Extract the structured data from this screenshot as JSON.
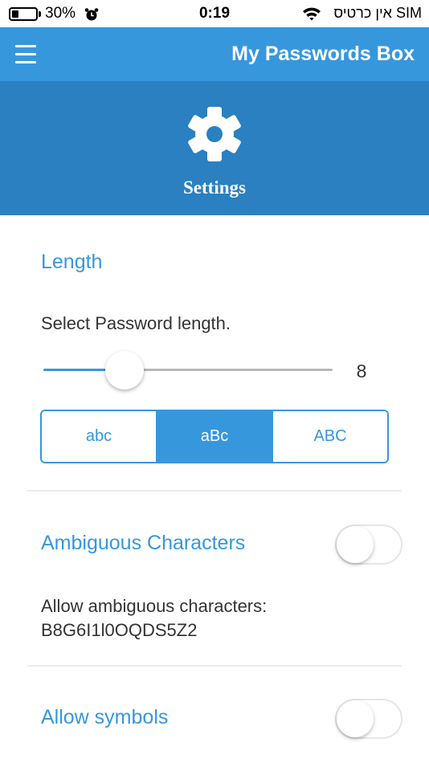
{
  "status_bar": {
    "battery_percent": "30%",
    "battery_level": 0.3,
    "time": "0:19",
    "carrier": "אין כרטיס SIM"
  },
  "app_bar": {
    "title": "My Passwords Box",
    "menu_icon": "hamburger-menu-icon"
  },
  "hero": {
    "icon": "gear-icon",
    "title": "Settings"
  },
  "length_section": {
    "title": "Length",
    "description": "Select Password length.",
    "slider_value": "8",
    "slider_fraction": 0.28,
    "case_options": [
      "abc",
      "aBc",
      "ABC"
    ],
    "selected_case": "aBc"
  },
  "ambiguous_section": {
    "title": "Ambiguous Characters",
    "toggle_on": false,
    "description_line1": "Allow ambiguous characters:",
    "description_line2": "B8G6I1l0OQDS5Z2"
  },
  "symbols_section": {
    "title": "Allow symbols",
    "toggle_on": false
  },
  "colors": {
    "app_bar": "#3797dd",
    "hero": "#2a80c1",
    "accent": "#3797dd"
  }
}
